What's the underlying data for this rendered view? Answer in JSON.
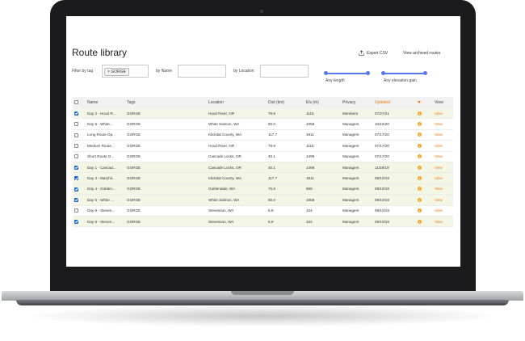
{
  "page": {
    "title": "Route library",
    "export_label": "Export CSV",
    "archived_label": "View archived routes"
  },
  "filters": {
    "tag_label": "Filter by tag",
    "tag_chip": "GORGE",
    "chip_remove": "×",
    "name_label": "by Name",
    "name_value": "",
    "location_label": "by Location",
    "location_value": ""
  },
  "sliders": {
    "length_label": "Any length",
    "elevation_label": "Any elevation gain"
  },
  "table": {
    "columns": [
      "",
      "Name",
      "Tags",
      "Location",
      "Dist (km)",
      "Elv (m)",
      "Privacy",
      "Updated",
      "",
      "View"
    ],
    "rows": [
      {
        "selected": true,
        "name": "Day 2 - Hood R...",
        "tags": "GORGE",
        "location": "Hood River, OR",
        "dist": "79.9",
        "elv": "1115",
        "privacy": "Members",
        "updated": "07/27/21",
        "view": "View"
      },
      {
        "selected": false,
        "name": "Day 5 - White...",
        "tags": "GORGE",
        "location": "White Salmon, WA",
        "dist": "60.0",
        "elv": "1058",
        "privacy": "Managers",
        "updated": "10/15/20",
        "view": "View"
      },
      {
        "selected": false,
        "name": "Long Route Op...",
        "tags": "GORGE",
        "location": "Klickitat County, WA",
        "dist": "117.7",
        "elv": "1911",
        "privacy": "Managers",
        "updated": "07/17/20",
        "view": "View"
      },
      {
        "selected": false,
        "name": "Medium Route ...",
        "tags": "GORGE",
        "location": "Hood River, OR",
        "dist": "79.9",
        "elv": "1115",
        "privacy": "Managers",
        "updated": "07/17/20",
        "view": "View"
      },
      {
        "selected": false,
        "name": "Short Route O...",
        "tags": "GORGE",
        "location": "Cascade Locks, OR",
        "dist": "40.1",
        "elv": "1499",
        "privacy": "Managers",
        "updated": "07/17/20",
        "view": "View"
      },
      {
        "selected": true,
        "name": "Day 1 - Cascad...",
        "tags": "GORGE",
        "location": "Cascade Locks, OR",
        "dist": "40.1",
        "elv": "1499",
        "privacy": "Managers",
        "updated": "11/28/19",
        "view": "View"
      },
      {
        "selected": true,
        "name": "Day 3 - Maryhil...",
        "tags": "GORGE",
        "location": "Klickitat County, WA",
        "dist": "117.7",
        "elv": "1911",
        "privacy": "Managers",
        "updated": "09/10/19",
        "view": "View"
      },
      {
        "selected": true,
        "name": "Day 4 - Golden...",
        "tags": "GORGE",
        "location": "Goldendale, WA",
        "dist": "76.8",
        "elv": "968",
        "privacy": "Managers",
        "updated": "09/10/19",
        "view": "View"
      },
      {
        "selected": true,
        "name": "Day 5 - White ...",
        "tags": "GORGE",
        "location": "White Salmon, WA",
        "dist": "60.0",
        "elv": "1058",
        "privacy": "Managers",
        "updated": "09/10/19",
        "view": "View"
      },
      {
        "selected": false,
        "name": "Day 6 - Steven...",
        "tags": "GORGE",
        "location": "Stevenson, WA",
        "dist": "6.9",
        "elv": "104",
        "privacy": "Managers",
        "updated": "09/10/19",
        "view": "View"
      },
      {
        "selected": true,
        "name": "Day 6 - Steven...",
        "tags": "GORGE",
        "location": "Stevenson, WA",
        "dist": "6.9",
        "elv": "104",
        "privacy": "Managers",
        "updated": "09/10/19",
        "view": "View"
      }
    ]
  },
  "colors": {
    "accent": "#f07a1a",
    "slider": "#5876ef",
    "checkbox": "#1e63d6",
    "selected_row": "#f3f6e4",
    "info": "#f5a623"
  },
  "icons": {
    "export": "upload-icon",
    "info": "info-icon",
    "sort": "sort-down-icon"
  }
}
